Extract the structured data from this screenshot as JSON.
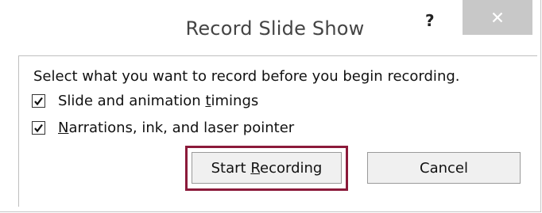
{
  "dialog": {
    "title": "Record Slide Show",
    "help_label": "?",
    "instruction": "Select what you want to record before you begin recording.",
    "options": [
      {
        "label_before": "Slide and animation ",
        "mnemonic": "t",
        "label_after": "imings",
        "checked": true
      },
      {
        "label_before": "",
        "mnemonic": "N",
        "label_after": "arrations, ink, and laser pointer",
        "checked": true
      }
    ],
    "start_button": {
      "before": "Start ",
      "mnemonic": "R",
      "after": "ecording"
    },
    "cancel_button": "Cancel"
  },
  "colors": {
    "highlight_border": "#8b1a3a",
    "close_button_bg": "#c8c8c8"
  }
}
